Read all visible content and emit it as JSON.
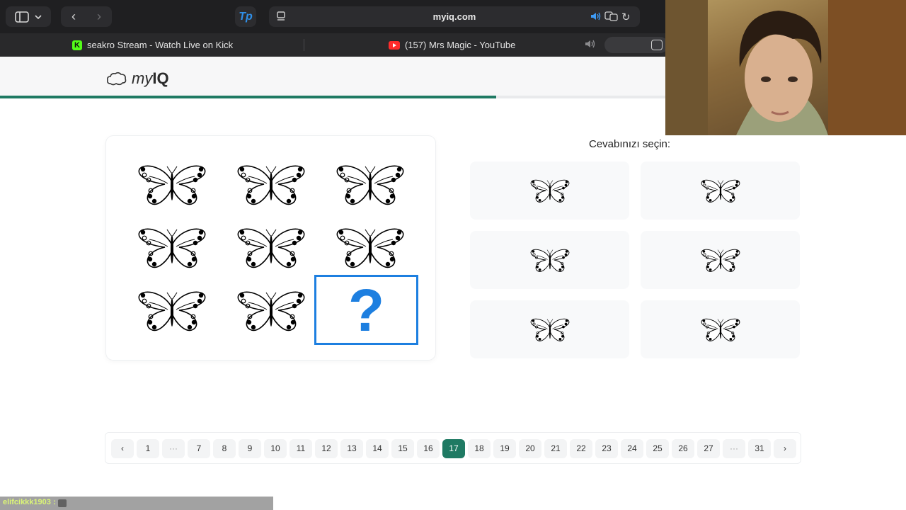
{
  "browser": {
    "url": "myiq.com",
    "extension_label": "Tp",
    "tabs": [
      {
        "title": "seakro Stream - Watch Live on Kick"
      },
      {
        "title": "(157) Mrs Magic - YouTube"
      }
    ]
  },
  "site": {
    "logo_light": "my",
    "logo_bold": "IQ",
    "progress_fraction": 0.548
  },
  "puzzle": {
    "question_mark": "?"
  },
  "answers": {
    "prompt": "Cevabınızı seçin:"
  },
  "pagination": {
    "prev_label": "‹",
    "next_label": "›",
    "items": [
      "1",
      "···",
      "7",
      "8",
      "9",
      "10",
      "11",
      "12",
      "13",
      "14",
      "15",
      "16",
      "17",
      "18",
      "19",
      "20",
      "21",
      "22",
      "23",
      "24",
      "25",
      "26",
      "27",
      "···",
      "31"
    ],
    "current": "17"
  },
  "chat": {
    "username": "elifcikkk1903 :"
  },
  "colors": {
    "accent_green": "#1f7a63",
    "question_blue": "#1d7fe0"
  }
}
